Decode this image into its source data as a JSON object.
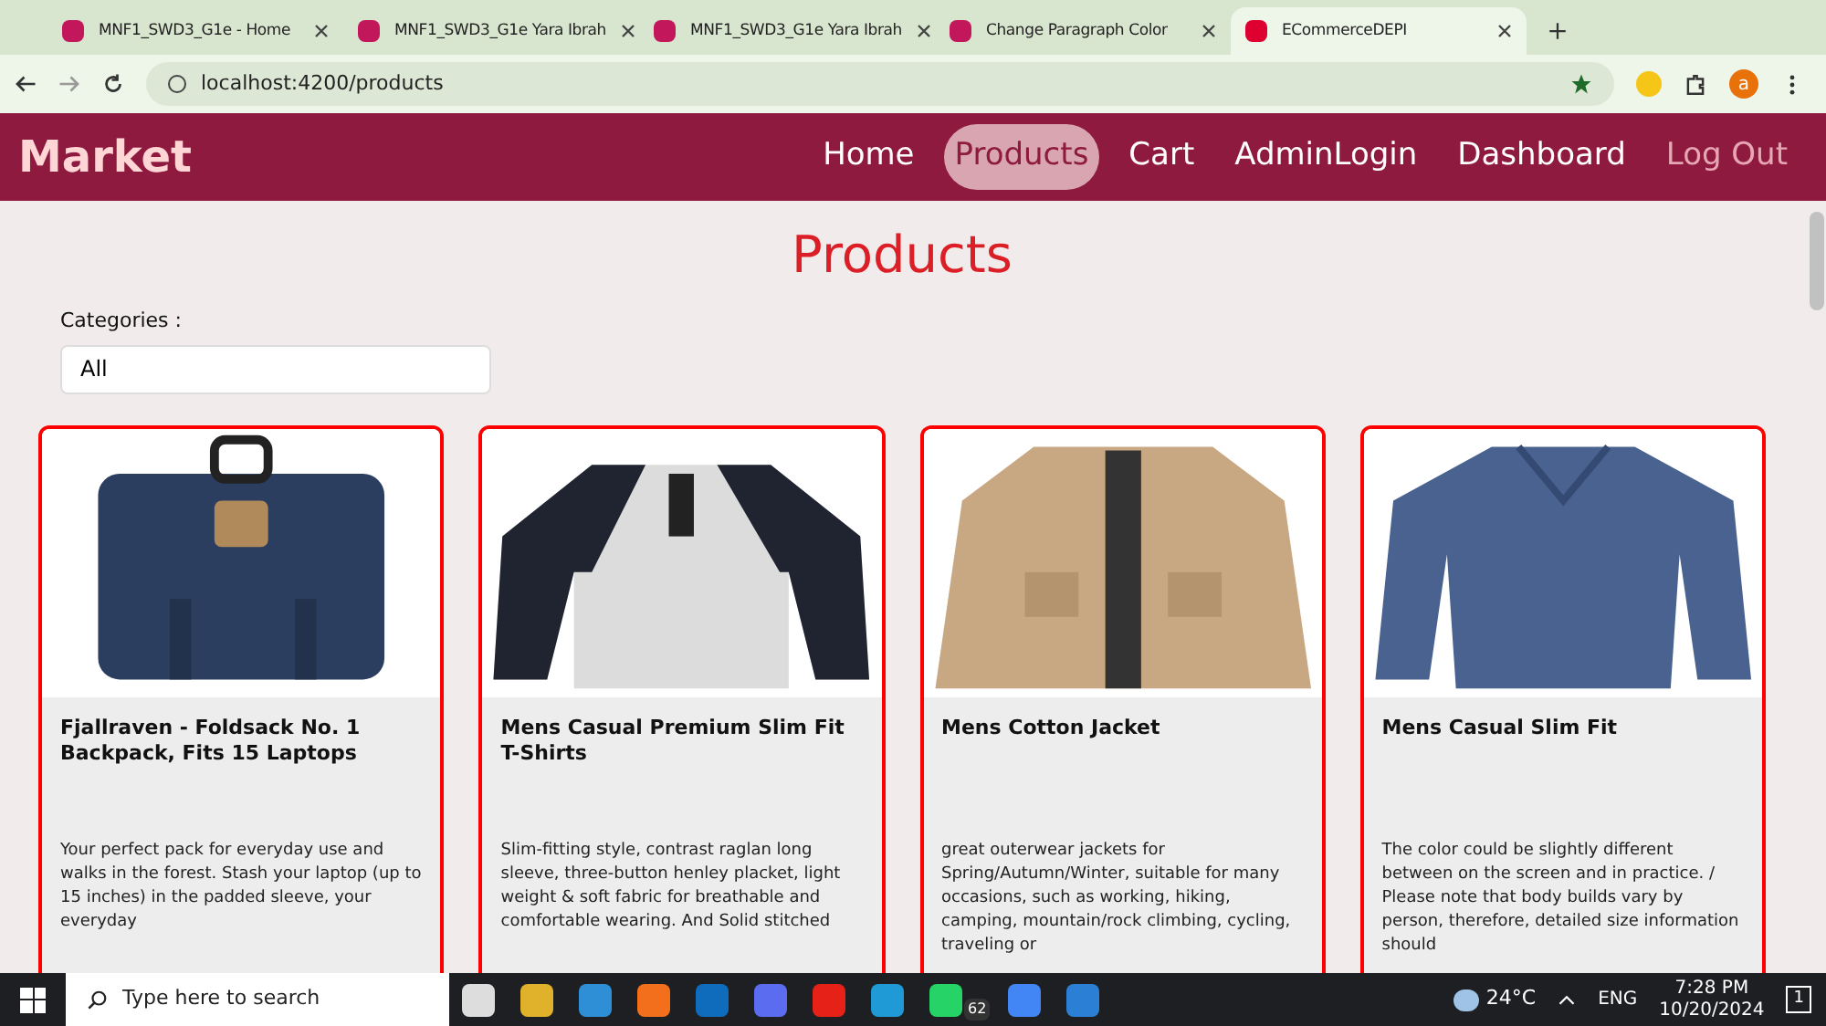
{
  "browser": {
    "tabs": [
      {
        "title": "MNF1_SWD3_G1e - Home",
        "selected": false
      },
      {
        "title": "MNF1_SWD3_G1e Yara Ibrah",
        "selected": false
      },
      {
        "title": "MNF1_SWD3_G1e Yara Ibrah",
        "selected": false
      },
      {
        "title": "Change Paragraph Color",
        "selected": false
      },
      {
        "title": "ECommerceDEPI",
        "selected": true
      }
    ],
    "url": "localhost:4200/products",
    "profile": "a"
  },
  "navbar": {
    "brand": "Market",
    "items": [
      {
        "label": "Home",
        "selected": false,
        "kind": "link"
      },
      {
        "label": "Products",
        "selected": true,
        "kind": "link"
      },
      {
        "label": "Cart",
        "selected": false,
        "kind": "link"
      },
      {
        "label": "AdminLogin",
        "selected": false,
        "kind": "link"
      },
      {
        "label": "Dashboard",
        "selected": false,
        "kind": "link"
      },
      {
        "label": "Log Out",
        "selected": false,
        "kind": "logout"
      }
    ]
  },
  "page": {
    "heading": "Products",
    "filter": {
      "label": "Categories :",
      "value": "All"
    }
  },
  "products": [
    {
      "title": "Fjallraven - Foldsack No. 1 Backpack, Fits 15 Laptops",
      "description": "Your perfect pack for everyday use and walks in the forest. Stash your laptop (up to 15 inches) in the padded sleeve, your everyday",
      "kind": "backpack"
    },
    {
      "title": "Mens Casual Premium Slim Fit T-Shirts",
      "description": "Slim-fitting style, contrast raglan long sleeve, three-button henley placket, light weight & soft fabric for breathable and comfortable wearing. And Solid stitched",
      "kind": "tshirt"
    },
    {
      "title": "Mens Cotton Jacket",
      "description": "great outerwear jackets for Spring/Autumn/Winter, suitable for many occasions, such as working, hiking, camping, mountain/rock climbing, cycling, traveling or",
      "kind": "jacket"
    },
    {
      "title": "Mens Casual Slim Fit",
      "description": "The color could be slightly different between on the screen and in practice. / Please note that body builds vary by person, therefore, detailed size information should",
      "kind": "sweater"
    }
  ],
  "taskbar": {
    "search_placeholder": "Type here to search",
    "whatsapp_badge": "62",
    "weather": "24°C",
    "language": "ENG",
    "time": "7:28 PM",
    "date": "10/20/2024",
    "notifications": "1"
  }
}
